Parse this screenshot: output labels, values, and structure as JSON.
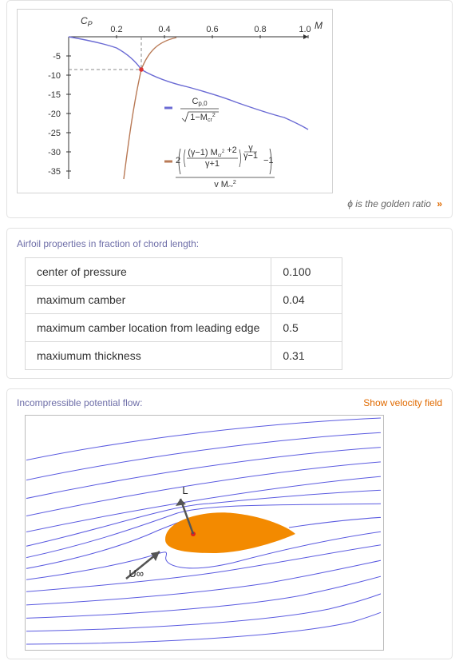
{
  "card1": {
    "footnote_prefix": "ϕ is the golden ratio",
    "footnote_chevron": "»"
  },
  "chart_data": {
    "type": "line",
    "xlabel": "M_cr",
    "ylabel": "C_P",
    "xlim": [
      0,
      1.0
    ],
    "ylim": [
      -37,
      0
    ],
    "xticks": [
      0.2,
      0.4,
      0.6,
      0.8,
      1.0
    ],
    "yticks": [
      -5,
      -10,
      -15,
      -20,
      -25,
      -30,
      -35
    ],
    "intersection": {
      "x": 0.302,
      "y": -8.5
    },
    "series": [
      {
        "name": "C_{p,0} / sqrt(1 - M_cr^2)",
        "color": "#6b6bd4",
        "approx_points": [
          {
            "x": 0.0,
            "y": 0.0
          },
          {
            "x": 0.2,
            "y": -3.0
          },
          {
            "x": 0.302,
            "y": -8.5
          },
          {
            "x": 0.5,
            "y": -13.0
          },
          {
            "x": 0.7,
            "y": -17.0
          },
          {
            "x": 0.9,
            "y": -21.0
          },
          {
            "x": 1.0,
            "y": -24.0
          }
        ]
      },
      {
        "name": "2(((γ-1)M_cr^2+2)/(γ+1))^{γ/(γ-1)} - 1) / (γ M_cr^2)",
        "color": "#b97a56",
        "approx_points": [
          {
            "x": 0.23,
            "y": -37.0
          },
          {
            "x": 0.26,
            "y": -20.0
          },
          {
            "x": 0.302,
            "y": -8.5
          },
          {
            "x": 0.37,
            "y": -2.0
          },
          {
            "x": 0.45,
            "y": 0.0
          }
        ]
      }
    ]
  },
  "props": {
    "title": "Airfoil properties in fraction of chord length:",
    "rows": [
      {
        "label": "center of pressure",
        "value": "0.100"
      },
      {
        "label": "maximum camber",
        "value": "0.04"
      },
      {
        "label": "maximum camber location from leading edge",
        "value": "0.5"
      },
      {
        "label": "maxiumum thickness",
        "value": "0.31"
      }
    ]
  },
  "flow": {
    "title": "Incompressible potential flow:",
    "link": "Show velocity field",
    "lift_label": "L",
    "freestream_label": "U∞"
  }
}
